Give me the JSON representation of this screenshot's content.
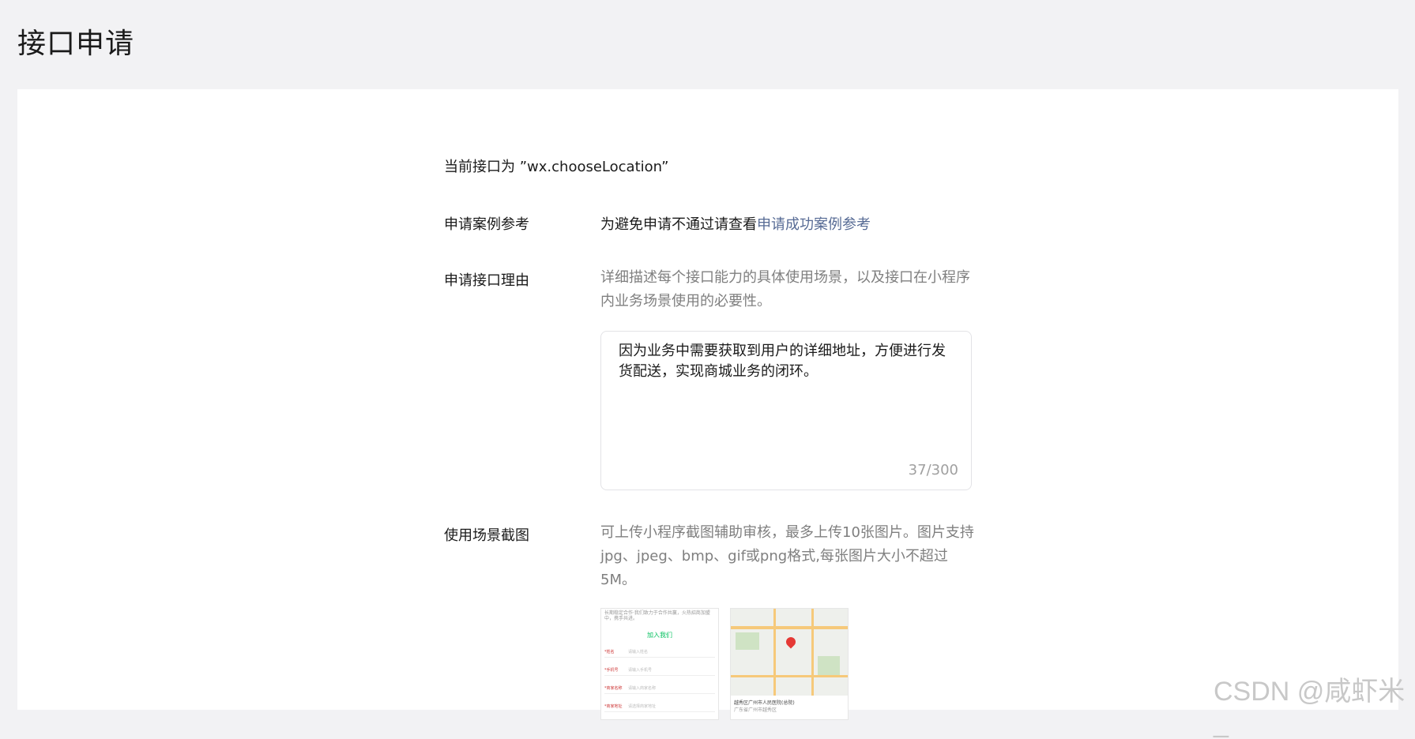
{
  "page_title": "接口申请",
  "current_api": "当前接口为 ”wx.chooseLocation”",
  "case_reference": {
    "label": "申请案例参考",
    "text": "为避免申请不通过请查看",
    "link": "申请成功案例参考"
  },
  "reason": {
    "label": "申请接口理由",
    "hint": "详细描述每个接口能力的具体使用场景，以及接口在小程序内业务场景使用的必要性。",
    "value": "因为业务中需要获取到用户的详细地址，方便进行发货配送，实现商城业务的闭环。",
    "counter": "37/300"
  },
  "screenshots": {
    "label": "使用场景截图",
    "hint": "可上传小程序截图辅助审核，最多上传10张图片。图片支持jpg、jpeg、bmp、gif或png格式,每张图片大小不超过5M。",
    "thumb_form": {
      "top_text": "长期稳定合作·我们致力于合作共赢，火热招商加盟中，携手共进。",
      "title": "加入我们",
      "rows": [
        {
          "label": "*姓名",
          "placeholder": "请输入姓名"
        },
        {
          "label": "*手机号",
          "placeholder": "请输入手机号"
        },
        {
          "label": "*商家名称",
          "placeholder": "请输入商家名称"
        },
        {
          "label": "*商家地址",
          "placeholder": "请选择商家地址"
        }
      ]
    },
    "thumb_map": {
      "footer_title": "越秀区广州市人民医院(总院)",
      "footer_sub": "广东省广州市越秀区"
    }
  },
  "watermark": "CSDN @咸虾米_",
  "colors": {
    "link": "#576b95",
    "hint": "#7f7f7f",
    "background": "#f2f2f4"
  }
}
